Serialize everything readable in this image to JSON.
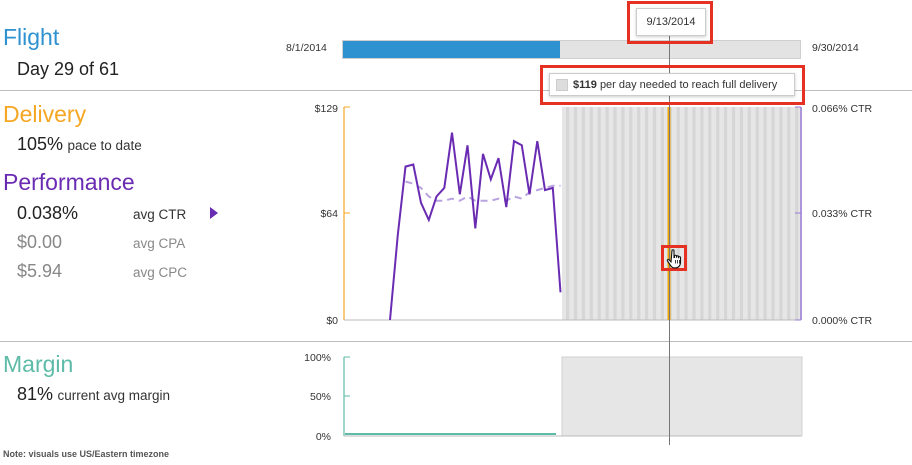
{
  "flight": {
    "title": "Flight",
    "subtitle": "Day 29 of 61",
    "start_date": "8/1/2014",
    "end_date": "9/30/2014",
    "progress_fraction": 0.475
  },
  "delivery": {
    "title": "Delivery",
    "value": "105%",
    "caption": "pace to date"
  },
  "performance": {
    "title": "Performance",
    "metrics": [
      {
        "value": "0.038%",
        "label": "avg CTR",
        "active": true
      },
      {
        "value": "$0.00",
        "label": "avg CPA",
        "active": false
      },
      {
        "value": "$5.94",
        "label": "avg CPC",
        "active": false
      }
    ]
  },
  "margin": {
    "title": "Margin",
    "value": "81%",
    "caption": "current avg margin"
  },
  "note": "Note: visuals use US/Eastern timezone",
  "tooltip_date": "9/13/2014",
  "tooltip_delivery": {
    "amount": "$119",
    "text": "per day needed to reach full delivery"
  },
  "colors": {
    "flight": "#2e91d0",
    "delivery": "#f5a623",
    "performance": "#6a2bb3",
    "margin": "#5dbba8",
    "highlight": "#e53122"
  },
  "chart_data": [
    {
      "type": "line",
      "y_left_ticks": [
        "$129",
        "$64",
        "$0"
      ],
      "y_right_ticks": [
        "0.066% CTR",
        "0.033% CTR",
        "0.000% CTR"
      ],
      "series": [
        {
          "values": [
            0.0,
            40,
            72,
            73,
            55,
            47,
            58,
            62,
            88,
            59,
            82,
            43,
            78,
            66,
            76,
            53,
            84,
            82,
            59,
            84,
            61,
            62,
            13
          ]
        },
        {
          "values": [
            null,
            null,
            65,
            64,
            62,
            58,
            56,
            56,
            57,
            56,
            58,
            56,
            56,
            56,
            57,
            56,
            58,
            57,
            60,
            61,
            62,
            63,
            63
          ]
        }
      ],
      "elapsed_days": 29,
      "total_days": 61
    },
    {
      "type": "area",
      "y_ticks": [
        "100%",
        "50%",
        "0%"
      ],
      "values": [
        0.0
      ]
    }
  ]
}
